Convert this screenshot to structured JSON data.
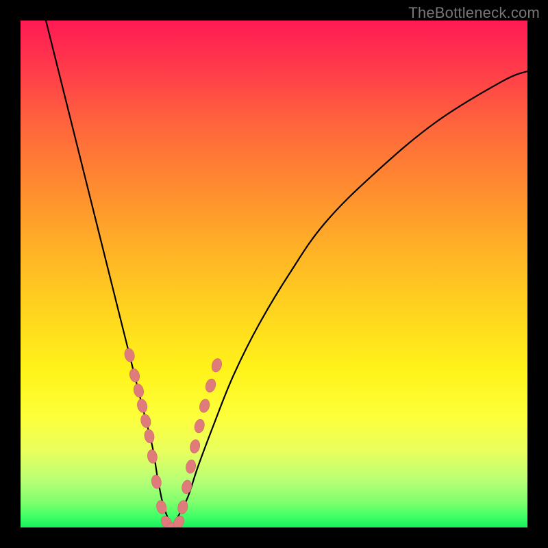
{
  "watermark": "TheBottleneck.com",
  "colors": {
    "background_frame": "#000000",
    "gradient_top": "#ff1a54",
    "gradient_mid": "#ffd61e",
    "gradient_bottom": "#17f05d",
    "curve": "#000000",
    "bead_fill": "#e07b7b",
    "bead_stroke": "#c46262"
  },
  "chart_data": {
    "type": "line",
    "title": "",
    "xlabel": "",
    "ylabel": "",
    "xlim": [
      0,
      100
    ],
    "ylim": [
      0,
      100
    ],
    "series": [
      {
        "name": "bottleneck-curve",
        "x": [
          5,
          8,
          11,
          14,
          17,
          20,
          22,
          24,
          26,
          27,
          28,
          29,
          30,
          31,
          33,
          35,
          38,
          42,
          47,
          53,
          60,
          70,
          82,
          95,
          100
        ],
        "y": [
          100,
          88,
          76,
          64,
          52,
          40,
          32,
          24,
          16,
          10,
          5,
          2,
          0,
          2,
          6,
          12,
          20,
          30,
          40,
          50,
          60,
          70,
          80,
          88,
          90
        ]
      }
    ],
    "markers": {
      "name": "beads",
      "note": "salmon elliptical markers clustered near curve minimum",
      "x": [
        21.5,
        22.5,
        23.3,
        24.0,
        24.7,
        25.4,
        26.0,
        26.8,
        27.8,
        28.8,
        30.0,
        31.2,
        32.0,
        32.8,
        33.6,
        34.4,
        35.3,
        36.3,
        37.5,
        38.7
      ],
      "y": [
        34,
        30,
        27,
        24,
        21,
        18,
        14,
        9,
        4,
        1,
        0,
        1,
        4,
        8,
        12,
        16,
        20,
        24,
        28,
        32
      ]
    }
  }
}
